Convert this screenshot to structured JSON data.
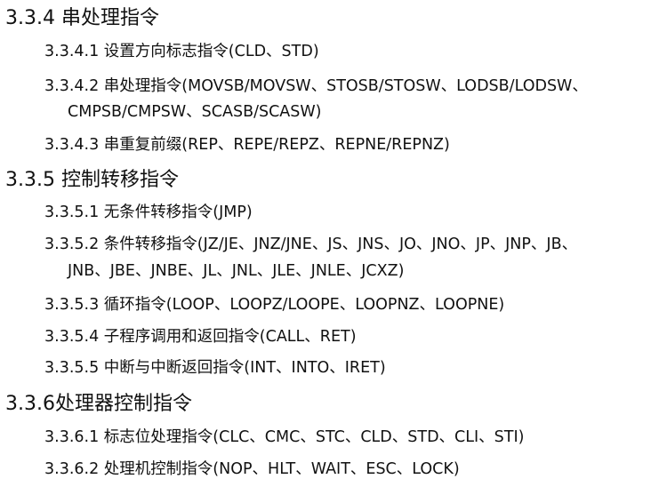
{
  "sections": [
    {
      "heading": "3.3.4 串处理指令",
      "items": [
        {
          "lines": [
            "3.3.4.1 设置方向标志指令(CLD、STD)"
          ]
        },
        {
          "lines": [
            "3.3.4.2 串处理指令(MOVSB/MOVSW、STOSB/STOSW、LODSB/LODSW、",
            "CMPSB/CMPSW、SCASB/SCASW)"
          ]
        },
        {
          "lines": [
            "3.3.4.3 串重复前缀(REP、REPE/REPZ、REPNE/REPNZ)"
          ]
        }
      ]
    },
    {
      "heading": "3.3.5 控制转移指令",
      "items": [
        {
          "lines": [
            "3.3.5.1 无条件转移指令(JMP)"
          ]
        },
        {
          "lines": [
            "3.3.5.2 条件转移指令(JZ/JE、JNZ/JNE、JS、JNS、JO、JNO、JP、JNP、JB、",
            "JNB、JBE、JNBE、JL、JNL、JLE、JNLE、JCXZ)"
          ]
        },
        {
          "lines": [
            "3.3.5.3 循环指令(LOOP、LOOPZ/LOOPE、LOOPNZ、LOOPNE)"
          ]
        },
        {
          "lines": [
            "3.3.5.4 子程序调用和返回指令(CALL、RET)"
          ]
        },
        {
          "lines": [
            "3.3.5.5 中断与中断返回指令(INT、INTO、IRET)"
          ]
        }
      ]
    },
    {
      "heading": "3.3.6处理器控制指令",
      "items": [
        {
          "lines": [
            "3.3.6.1 标志位处理指令(CLC、CMC、STC、CLD、STD、CLI、STI)"
          ]
        },
        {
          "lines": [
            "3.3.6.2 处理机控制指令(NOP、HLT、WAIT、ESC、LOCK)"
          ]
        }
      ]
    }
  ]
}
